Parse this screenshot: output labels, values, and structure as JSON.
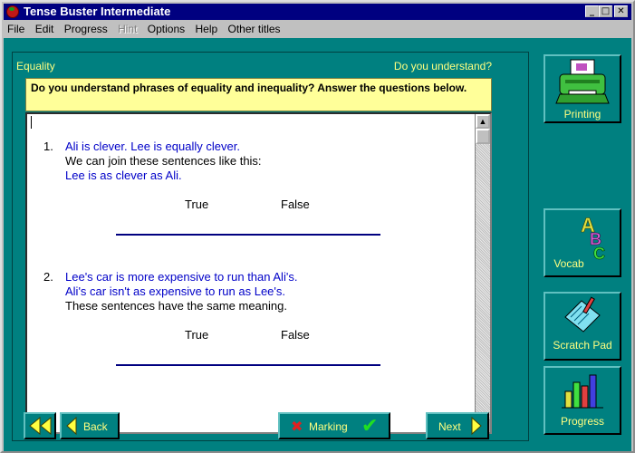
{
  "window": {
    "title": "Tense Buster Intermediate",
    "controls": [
      "minimize-icon",
      "maximize-icon",
      "close-icon"
    ]
  },
  "menu": {
    "items": [
      "File",
      "Edit",
      "Progress",
      "Hint",
      "Options",
      "Help",
      "Other titles"
    ],
    "disabled": [
      "Hint"
    ]
  },
  "lesson": {
    "topic": "Equality",
    "section": "Do you understand?",
    "instruction": "Do you understand phrases of equality and inequality? Answer the questions below."
  },
  "questions": [
    {
      "number": "1.",
      "lines": [
        {
          "text": "Ali is clever. Lee is equally clever.",
          "color": "blue"
        },
        {
          "text": "We can join these sentences like this:",
          "color": "black"
        },
        {
          "text": "Lee is as clever as Ali.",
          "color": "blue"
        }
      ],
      "options": [
        "True",
        "False"
      ]
    },
    {
      "number": "2.",
      "lines": [
        {
          "text": "Lee's car is more expensive to run than Ali's.",
          "color": "blue"
        },
        {
          "text": "Ali's car isn't as expensive to run as Lee's.",
          "color": "blue"
        },
        {
          "text": "These sentences have the same meaning.",
          "color": "black"
        }
      ],
      "options": [
        "True",
        "False"
      ]
    }
  ],
  "sidebar": {
    "printing": "Printing",
    "vocab": "Vocab",
    "scratch": "Scratch Pad",
    "progress": "Progress"
  },
  "nav": {
    "back": "Back",
    "marking": "Marking",
    "next": "Next"
  },
  "colors": {
    "background": "#008080",
    "label": "#ffff80",
    "instruction_bg": "#ffff99",
    "question_text": "#0000c8"
  }
}
